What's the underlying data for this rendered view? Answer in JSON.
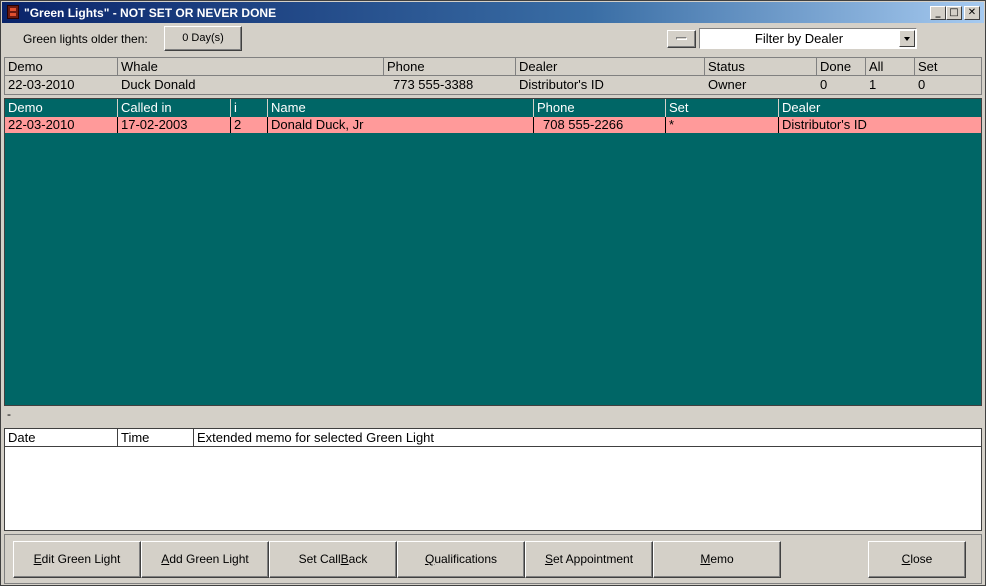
{
  "window": {
    "title": "\"Green Lights\" - NOT SET OR NEVER DONE",
    "minimize_glyph": "_",
    "maximize_glyph": "□",
    "close_glyph": "✕"
  },
  "toolbar": {
    "older_label": "Green lights older then:",
    "days_button": "0 Day(s)",
    "filter_value": "Filter by Dealer"
  },
  "whale_table": {
    "columns": [
      "Demo",
      "Whale",
      "Phone",
      "Dealer",
      "Status",
      "Done",
      "All",
      "Set"
    ],
    "row": [
      "22-03-2010",
      "Duck Donald",
      "773 555-3388",
      "Distributor's ID",
      "Owner",
      "0",
      "1",
      "0"
    ]
  },
  "green_lights": {
    "columns": [
      "Demo",
      "Called in",
      "i",
      "Name",
      "Phone",
      "Set",
      "Dealer"
    ],
    "rows": [
      [
        "22-03-2010",
        "17-02-2003",
        "2",
        "Donald Duck, Jr",
        "708 555-2266",
        "*",
        "Distributor's ID"
      ]
    ]
  },
  "separator_text": "-",
  "memo": {
    "columns": [
      "Date",
      "Time",
      "Extended memo for selected Green Light"
    ]
  },
  "buttons": {
    "edit": {
      "pre": "",
      "key": "E",
      "post": "dit Green Light"
    },
    "add": {
      "pre": "",
      "key": "A",
      "post": "dd Green Light"
    },
    "callback": {
      "pre": "Set Call",
      "key": "B",
      "post": "ack"
    },
    "qualifications": {
      "pre": "",
      "key": "Q",
      "post": "ualifications"
    },
    "appointment": {
      "pre": "",
      "key": "S",
      "post": "et Appointment"
    },
    "memo": {
      "pre": "",
      "key": "M",
      "post": "emo"
    },
    "close": {
      "pre": "",
      "key": "C",
      "post": "lose"
    }
  }
}
